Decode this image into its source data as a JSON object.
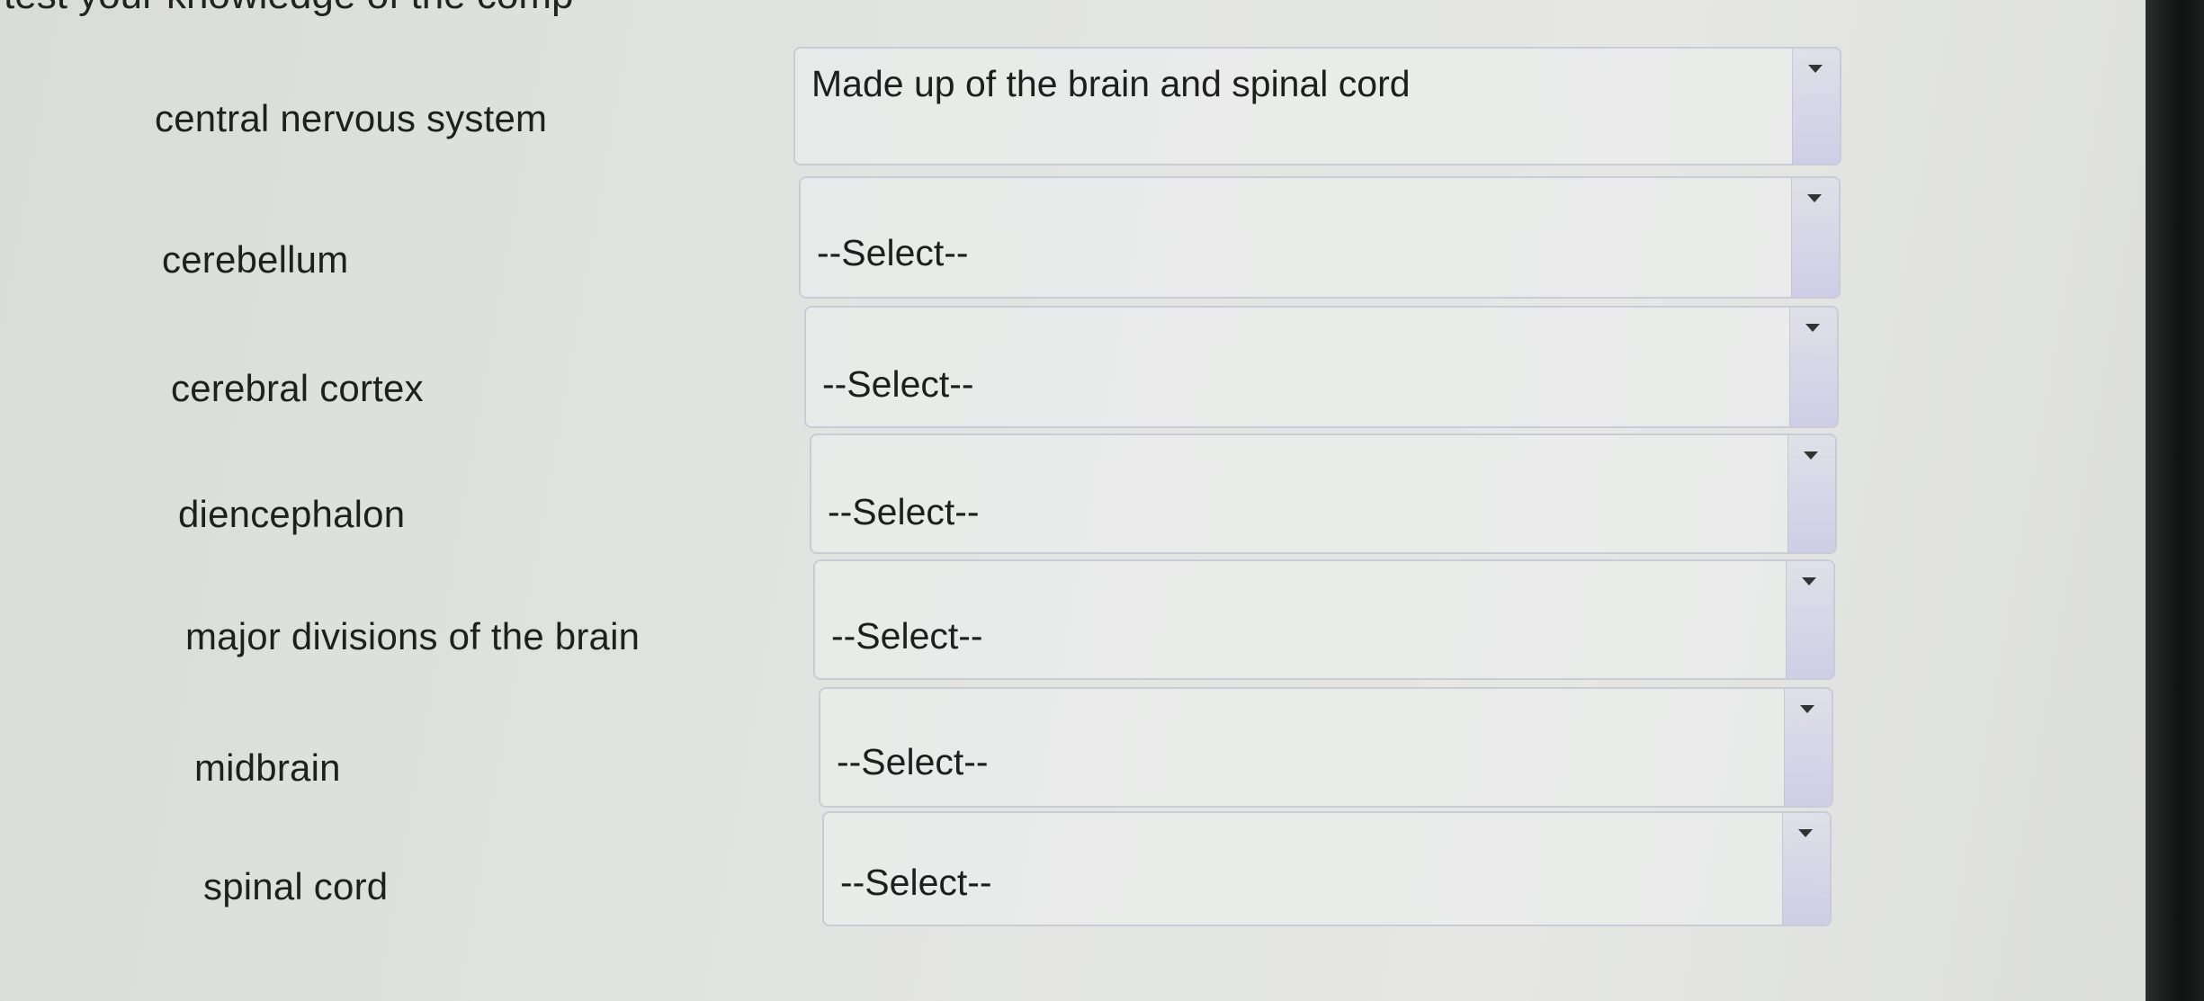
{
  "header": {
    "partial_title": "test your knowledge of the comp"
  },
  "rows": [
    {
      "term": "central nervous system",
      "selected": "Made up of the brain and spinal cord"
    },
    {
      "term": "cerebellum",
      "selected": "--Select--"
    },
    {
      "term": "cerebral cortex",
      "selected": "--Select--"
    },
    {
      "term": "diencephalon",
      "selected": "--Select--"
    },
    {
      "term": "major divisions of the brain",
      "selected": "--Select--"
    },
    {
      "term": "midbrain",
      "selected": "--Select--"
    },
    {
      "term": "spinal cord",
      "selected": "--Select--"
    }
  ],
  "icons": {
    "dropdown": "chevron-down-icon"
  }
}
